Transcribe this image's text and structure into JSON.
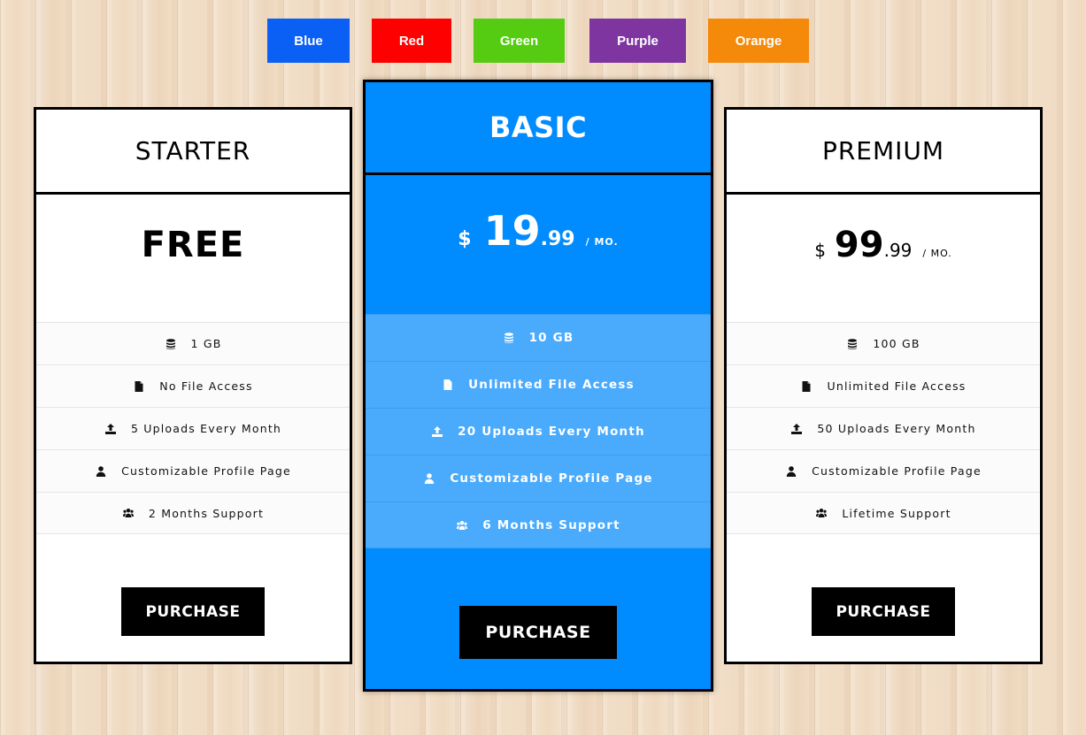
{
  "color_switcher": [
    {
      "label": "Blue",
      "color": "#0a5ff5"
    },
    {
      "label": "Red",
      "color": "#ff0000"
    },
    {
      "label": "Green",
      "color": "#55cc11"
    },
    {
      "label": "Purple",
      "color": "#7f35a0"
    },
    {
      "label": "Orange",
      "color": "#f5890a"
    }
  ],
  "plans": [
    {
      "name": "STARTER",
      "price_text": "FREE",
      "features": [
        {
          "icon": "database-icon",
          "text": "1 GB"
        },
        {
          "icon": "file-icon",
          "text": "No File Access"
        },
        {
          "icon": "upload-icon",
          "text": "5 Uploads Every Month"
        },
        {
          "icon": "user-icon",
          "text": "Customizable Profile Page"
        },
        {
          "icon": "users-icon",
          "text": "2 Months Support"
        }
      ],
      "button": "PURCHASE"
    },
    {
      "name": "BASIC",
      "currency": "$",
      "price_whole": "19",
      "price_cents": ".99",
      "period": "/ MO.",
      "accent": "#008cff",
      "features": [
        {
          "icon": "database-icon",
          "text": "10 GB"
        },
        {
          "icon": "file-icon",
          "text": "Unlimited File Access"
        },
        {
          "icon": "upload-icon",
          "text": "20 Uploads Every Month"
        },
        {
          "icon": "user-icon",
          "text": "Customizable Profile Page"
        },
        {
          "icon": "users-icon",
          "text": "6 Months Support"
        }
      ],
      "button": "PURCHASE"
    },
    {
      "name": "PREMIUM",
      "currency": "$",
      "price_whole": "99",
      "price_cents": ".99",
      "period": "/ MO.",
      "features": [
        {
          "icon": "database-icon",
          "text": "100 GB"
        },
        {
          "icon": "file-icon",
          "text": "Unlimited File Access"
        },
        {
          "icon": "upload-icon",
          "text": "50 Uploads Every Month"
        },
        {
          "icon": "user-icon",
          "text": "Customizable Profile Page"
        },
        {
          "icon": "users-icon",
          "text": "Lifetime Support"
        }
      ],
      "button": "PURCHASE"
    }
  ]
}
